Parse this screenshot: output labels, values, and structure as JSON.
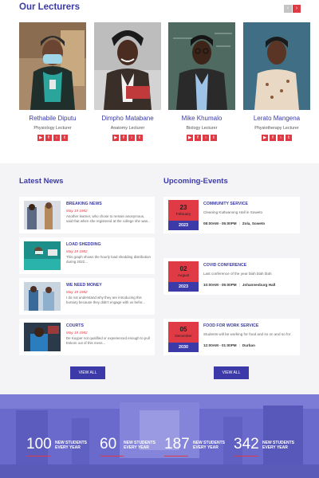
{
  "lecturers": {
    "title": "Our Lecturers",
    "prev_icon": "chevron-left-icon",
    "next_icon": "chevron-right-icon",
    "items": [
      {
        "name": "Rethabile Diputu",
        "role": "Physiology Lecturer"
      },
      {
        "name": "Dimpho Matabane",
        "role": "Anatomy Lecturer"
      },
      {
        "name": "Mike Khumalo",
        "role": "Biology Lecturer"
      },
      {
        "name": "Lerato Mangena",
        "role": "Physiotherapy Lecturer"
      }
    ],
    "social_icons": [
      "youtube-icon",
      "facebook-icon",
      "instagram-icon",
      "twitter-icon"
    ]
  },
  "news": {
    "title": "Latest News",
    "items": [
      {
        "headline": "BREAKING NEWS",
        "date": "May 19 1982",
        "text": "Another learner, who chose to remain anonymous, said that when she registered at the college she was..."
      },
      {
        "headline": "LOAD SHEDDING",
        "date": "May 19 1982",
        "text": "This graph shows the hourly load shedding distribution during 2022..."
      },
      {
        "headline": "WE NEED MONEY",
        "date": "May 19 1982",
        "text": "I do not understand why they are introducing this bursary because they didn't engage with us befor..."
      },
      {
        "headline": "COURTS",
        "date": "May 19 1982",
        "text": "De Kuyper not qualified or experienced enough to pull Eskom out of this mess..."
      }
    ],
    "view_all": "VIEW ALL"
  },
  "events": {
    "title": "Upcoming-Events",
    "items": [
      {
        "day": "23",
        "month": "February",
        "year": "2023",
        "title": "COMMUNITY SERVICE",
        "desc": "Cleaning Kutlwanong Hall in Soweto",
        "time": "08:00AM - 05:00PM",
        "place": "Zola, Soweto"
      },
      {
        "day": "02",
        "month": "August",
        "year": "2023",
        "title": "COVID CONFERENCE",
        "desc": "Last conference of the year blah blah blah",
        "time": "10:00AM - 05:00PM",
        "place": "Johannesburg Hall"
      },
      {
        "day": "05",
        "month": "December",
        "year": "2030",
        "title": "FOOD FOR WORK SERVICE",
        "desc": "Students will be working for food and so on and so for",
        "time": "12:00AM - 01:00PM",
        "place": "Durban"
      }
    ],
    "view_all": "VIEW ALL"
  },
  "stats": [
    {
      "number": "100",
      "label_line1": "NEW STUDENTS",
      "label_line2": "EVERY YEAR"
    },
    {
      "number": "60",
      "label_line1": "NEW STUDENTS",
      "label_line2": "EVERY YEAR"
    },
    {
      "number": "187",
      "label_line1": "NEW STUDENTS",
      "label_line2": "EVERY YEAR"
    },
    {
      "number": "342",
      "label_line1": "NEW STUDENTS",
      "label_line2": "EVERY YEAR"
    }
  ],
  "colors": {
    "primary": "#3b3aa8",
    "accent": "#e03a45",
    "section_bg": "#f4f4f6"
  }
}
